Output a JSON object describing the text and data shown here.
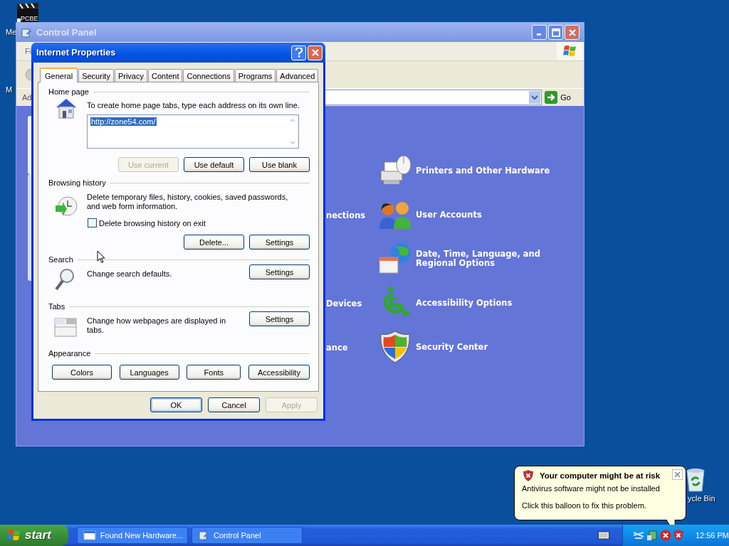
{
  "desktop_icons": [
    {
      "kind": "clapper",
      "badge": "PCBE",
      "label": "Me"
    },
    {
      "kind": "hidden",
      "label": "M"
    },
    {
      "kind": "recycle",
      "label": "ycle Bin"
    }
  ],
  "control_panel": {
    "title": "Control Panel",
    "menu": [
      "Fi"
    ],
    "address_label": "Ad",
    "go": "Go",
    "rows": [
      {
        "kind": "printer",
        "label": "Printers and Other Hardware"
      },
      {
        "left_label": "nections",
        "kind": "users",
        "label": "User Accounts"
      },
      {
        "kind": "globe",
        "label": "Date, Time, Language, and Regional Options"
      },
      {
        "left_label": "Devices",
        "kind": "wheelchair",
        "label": "Accessibility Options"
      },
      {
        "left_label": "ance",
        "kind": "shield",
        "label": "Security Center"
      }
    ]
  },
  "dialog": {
    "title": "Internet Properties",
    "tabs": [
      {
        "label": "General",
        "selected": true
      },
      {
        "label": "Security",
        "selected": false
      },
      {
        "label": "Privacy",
        "selected": false
      },
      {
        "label": "Content",
        "selected": false
      },
      {
        "label": "Connections",
        "selected": false
      },
      {
        "label": "Programs",
        "selected": false
      },
      {
        "label": "Advanced",
        "selected": false
      }
    ],
    "sections": [
      {
        "kind": "homepage",
        "title": "Home page",
        "text": "To create home page tabs, type each address on its own line.",
        "field": {
          "value": "http://zone54.com/",
          "highlighted": true
        },
        "buttons": [
          {
            "label": "Use current",
            "disabled": true
          },
          {
            "label": "Use default",
            "disabled": false
          },
          {
            "label": "Use blank",
            "disabled": false
          }
        ]
      },
      {
        "kind": "history",
        "title": "Browsing history",
        "text": "Delete temporary files, history, cookies, saved passwords, and web form information.",
        "checkbox": {
          "label": "Delete browsing history on exit",
          "checked": false
        },
        "buttons": [
          {
            "label": "Delete...",
            "disabled": false
          },
          {
            "label": "Settings",
            "disabled": false
          }
        ]
      },
      {
        "kind": "search",
        "title": "Search",
        "text": "Change search defaults.",
        "buttons": [
          {
            "label": "Settings",
            "disabled": false
          }
        ]
      },
      {
        "kind": "tabs",
        "title": "Tabs",
        "text": "Change how webpages are displayed in tabs.",
        "buttons": [
          {
            "label": "Settings",
            "disabled": false
          }
        ]
      },
      {
        "kind": "appearance",
        "title": "Appearance",
        "buttons": [
          {
            "label": "Colors",
            "disabled": false
          },
          {
            "label": "Languages",
            "disabled": false
          },
          {
            "label": "Fonts",
            "disabled": false
          },
          {
            "label": "Accessibility",
            "disabled": false
          }
        ]
      }
    ],
    "buttons": [
      {
        "label": "OK",
        "disabled": false
      },
      {
        "label": "Cancel",
        "disabled": false
      },
      {
        "label": "Apply",
        "disabled": true
      }
    ]
  },
  "balloon": {
    "title": "Your computer might be at risk",
    "lines": [
      "Antivirus software might not be installed",
      "Click this balloon to fix this problem."
    ]
  },
  "taskbar": {
    "start": "start",
    "tasks": [
      {
        "kind": "hardware",
        "label": "Found New Hardware..."
      },
      {
        "kind": "control",
        "label": "Control Panel"
      }
    ],
    "clock": "12:56 PM"
  }
}
